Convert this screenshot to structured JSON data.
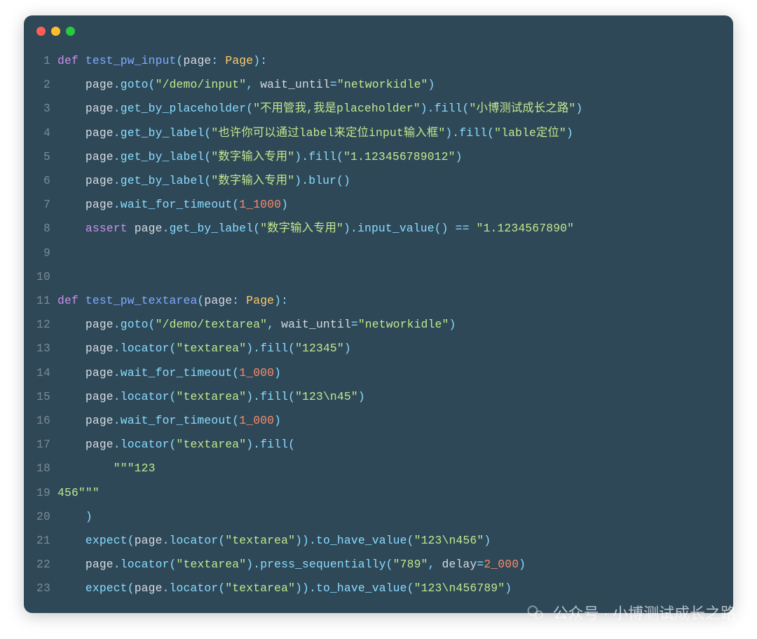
{
  "window": {
    "dots": [
      "red",
      "yellow",
      "green"
    ]
  },
  "code": {
    "lines": [
      {
        "n": "1",
        "t": [
          [
            "kw",
            "def "
          ],
          [
            "fn",
            "test_pw_input"
          ],
          [
            "punc",
            "("
          ],
          [
            "param",
            "page"
          ],
          [
            "punc",
            ": "
          ],
          [
            "type",
            "Page"
          ],
          [
            "punc",
            ")"
          ],
          [
            "punc",
            ":"
          ]
        ]
      },
      {
        "n": "2",
        "t": [
          [
            "plain",
            "    page"
          ],
          [
            "punc",
            "."
          ],
          [
            "prop",
            "goto"
          ],
          [
            "punc",
            "("
          ],
          [
            "str",
            "\"/demo/input\""
          ],
          [
            "punc",
            ", "
          ],
          [
            "param",
            "wait_until"
          ],
          [
            "punc",
            "="
          ],
          [
            "str",
            "\"networkidle\""
          ],
          [
            "punc",
            ")"
          ]
        ]
      },
      {
        "n": "3",
        "t": [
          [
            "plain",
            "    page"
          ],
          [
            "punc",
            "."
          ],
          [
            "prop",
            "get_by_placeholder"
          ],
          [
            "punc",
            "("
          ],
          [
            "str",
            "\"不用管我,我是placeholder\""
          ],
          [
            "punc",
            ")."
          ],
          [
            "prop",
            "fill"
          ],
          [
            "punc",
            "("
          ],
          [
            "str",
            "\"小博测试成长之路\""
          ],
          [
            "punc",
            ")"
          ]
        ]
      },
      {
        "n": "4",
        "t": [
          [
            "plain",
            "    page"
          ],
          [
            "punc",
            "."
          ],
          [
            "prop",
            "get_by_label"
          ],
          [
            "punc",
            "("
          ],
          [
            "str",
            "\"也许你可以通过label来定位input输入框\""
          ],
          [
            "punc",
            ")."
          ],
          [
            "prop",
            "fill"
          ],
          [
            "punc",
            "("
          ],
          [
            "str",
            "\"lable定位\""
          ],
          [
            "punc",
            ")"
          ]
        ]
      },
      {
        "n": "5",
        "t": [
          [
            "plain",
            "    page"
          ],
          [
            "punc",
            "."
          ],
          [
            "prop",
            "get_by_label"
          ],
          [
            "punc",
            "("
          ],
          [
            "str",
            "\"数字输入专用\""
          ],
          [
            "punc",
            ")."
          ],
          [
            "prop",
            "fill"
          ],
          [
            "punc",
            "("
          ],
          [
            "str",
            "\"1.123456789012\""
          ],
          [
            "punc",
            ")"
          ]
        ]
      },
      {
        "n": "6",
        "t": [
          [
            "plain",
            "    page"
          ],
          [
            "punc",
            "."
          ],
          [
            "prop",
            "get_by_label"
          ],
          [
            "punc",
            "("
          ],
          [
            "str",
            "\"数字输入专用\""
          ],
          [
            "punc",
            ")."
          ],
          [
            "prop",
            "blur"
          ],
          [
            "punc",
            "()"
          ]
        ]
      },
      {
        "n": "7",
        "t": [
          [
            "plain",
            "    page"
          ],
          [
            "punc",
            "."
          ],
          [
            "prop",
            "wait_for_timeout"
          ],
          [
            "punc",
            "("
          ],
          [
            "num",
            "1_1000"
          ],
          [
            "punc",
            ")"
          ]
        ]
      },
      {
        "n": "8",
        "t": [
          [
            "plain",
            "    "
          ],
          [
            "kw",
            "assert"
          ],
          [
            "plain",
            " page"
          ],
          [
            "punc",
            "."
          ],
          [
            "prop",
            "get_by_label"
          ],
          [
            "punc",
            "("
          ],
          [
            "str",
            "\"数字输入专用\""
          ],
          [
            "punc",
            ")."
          ],
          [
            "prop",
            "input_value"
          ],
          [
            "punc",
            "() == "
          ],
          [
            "str",
            "\"1.1234567890\""
          ]
        ]
      },
      {
        "n": "9",
        "t": [
          [
            "plain",
            ""
          ]
        ]
      },
      {
        "n": "10",
        "t": [
          [
            "plain",
            ""
          ]
        ]
      },
      {
        "n": "11",
        "t": [
          [
            "kw",
            "def "
          ],
          [
            "fn",
            "test_pw_textarea"
          ],
          [
            "punc",
            "("
          ],
          [
            "param",
            "page"
          ],
          [
            "punc",
            ": "
          ],
          [
            "type",
            "Page"
          ],
          [
            "punc",
            ")"
          ],
          [
            "punc",
            ":"
          ]
        ]
      },
      {
        "n": "12",
        "t": [
          [
            "plain",
            "    page"
          ],
          [
            "punc",
            "."
          ],
          [
            "prop",
            "goto"
          ],
          [
            "punc",
            "("
          ],
          [
            "str",
            "\"/demo/textarea\""
          ],
          [
            "punc",
            ", "
          ],
          [
            "param",
            "wait_until"
          ],
          [
            "punc",
            "="
          ],
          [
            "str",
            "\"networkidle\""
          ],
          [
            "punc",
            ")"
          ]
        ]
      },
      {
        "n": "13",
        "t": [
          [
            "plain",
            "    page"
          ],
          [
            "punc",
            "."
          ],
          [
            "prop",
            "locator"
          ],
          [
            "punc",
            "("
          ],
          [
            "str",
            "\"textarea\""
          ],
          [
            "punc",
            ")."
          ],
          [
            "prop",
            "fill"
          ],
          [
            "punc",
            "("
          ],
          [
            "str",
            "\"12345\""
          ],
          [
            "punc",
            ")"
          ]
        ]
      },
      {
        "n": "14",
        "t": [
          [
            "plain",
            "    page"
          ],
          [
            "punc",
            "."
          ],
          [
            "prop",
            "wait_for_timeout"
          ],
          [
            "punc",
            "("
          ],
          [
            "num",
            "1_000"
          ],
          [
            "punc",
            ")"
          ]
        ]
      },
      {
        "n": "15",
        "t": [
          [
            "plain",
            "    page"
          ],
          [
            "punc",
            "."
          ],
          [
            "prop",
            "locator"
          ],
          [
            "punc",
            "("
          ],
          [
            "str",
            "\"textarea\""
          ],
          [
            "punc",
            ")."
          ],
          [
            "prop",
            "fill"
          ],
          [
            "punc",
            "("
          ],
          [
            "str",
            "\"123\\n45\""
          ],
          [
            "punc",
            ")"
          ]
        ]
      },
      {
        "n": "16",
        "t": [
          [
            "plain",
            "    page"
          ],
          [
            "punc",
            "."
          ],
          [
            "prop",
            "wait_for_timeout"
          ],
          [
            "punc",
            "("
          ],
          [
            "num",
            "1_000"
          ],
          [
            "punc",
            ")"
          ]
        ]
      },
      {
        "n": "17",
        "t": [
          [
            "plain",
            "    page"
          ],
          [
            "punc",
            "."
          ],
          [
            "prop",
            "locator"
          ],
          [
            "punc",
            "("
          ],
          [
            "str",
            "\"textarea\""
          ],
          [
            "punc",
            ")."
          ],
          [
            "prop",
            "fill"
          ],
          [
            "punc",
            "("
          ]
        ]
      },
      {
        "n": "18",
        "t": [
          [
            "plain",
            "        "
          ],
          [
            "str",
            "\"\"\"123"
          ]
        ]
      },
      {
        "n": "19",
        "t": [
          [
            "str",
            "456\"\"\""
          ]
        ]
      },
      {
        "n": "20",
        "t": [
          [
            "plain",
            "    "
          ],
          [
            "punc",
            ")"
          ]
        ]
      },
      {
        "n": "21",
        "t": [
          [
            "plain",
            "    "
          ],
          [
            "prop",
            "expect"
          ],
          [
            "punc",
            "("
          ],
          [
            "plain",
            "page"
          ],
          [
            "punc",
            "."
          ],
          [
            "prop",
            "locator"
          ],
          [
            "punc",
            "("
          ],
          [
            "str",
            "\"textarea\""
          ],
          [
            "punc",
            "))."
          ],
          [
            "prop",
            "to_have_value"
          ],
          [
            "punc",
            "("
          ],
          [
            "str",
            "\"123\\n456\""
          ],
          [
            "punc",
            ")"
          ]
        ]
      },
      {
        "n": "22",
        "t": [
          [
            "plain",
            "    page"
          ],
          [
            "punc",
            "."
          ],
          [
            "prop",
            "locator"
          ],
          [
            "punc",
            "("
          ],
          [
            "str",
            "\"textarea\""
          ],
          [
            "punc",
            ")."
          ],
          [
            "prop",
            "press_sequentially"
          ],
          [
            "punc",
            "("
          ],
          [
            "str",
            "\"789\""
          ],
          [
            "punc",
            ", "
          ],
          [
            "param",
            "delay"
          ],
          [
            "punc",
            "="
          ],
          [
            "num",
            "2_000"
          ],
          [
            "punc",
            ")"
          ]
        ]
      },
      {
        "n": "23",
        "t": [
          [
            "plain",
            "    "
          ],
          [
            "prop",
            "expect"
          ],
          [
            "punc",
            "("
          ],
          [
            "plain",
            "page"
          ],
          [
            "punc",
            "."
          ],
          [
            "prop",
            "locator"
          ],
          [
            "punc",
            "("
          ],
          [
            "str",
            "\"textarea\""
          ],
          [
            "punc",
            "))."
          ],
          [
            "prop",
            "to_have_value"
          ],
          [
            "punc",
            "("
          ],
          [
            "str",
            "\"123\\n456789\""
          ],
          [
            "punc",
            ")"
          ]
        ]
      }
    ]
  },
  "watermark": {
    "text": "公众号 · 小博测试成长之路"
  }
}
